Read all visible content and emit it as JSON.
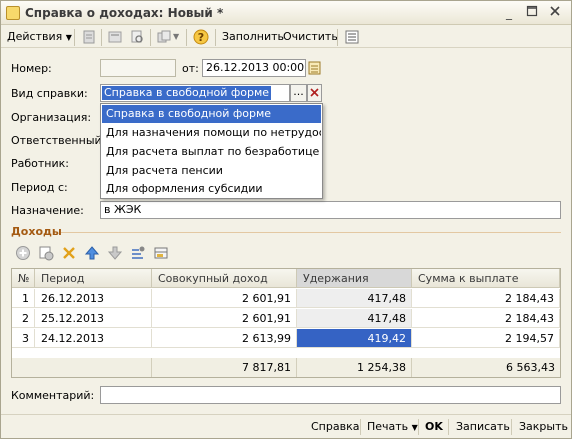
{
  "window": {
    "title": "Справка о доходах: Новый *"
  },
  "toolbar": {
    "actions_label": "Действия",
    "fill_label": "Заполнить",
    "clear_label": "Очистить"
  },
  "form": {
    "number_label": "Номер:",
    "number_value": "",
    "from_label": "от:",
    "date_value": "26.12.2013 00:00:00",
    "cert_type_label": "Вид справки:",
    "cert_type_value": "Справка в свободной форме",
    "org_label": "Организация:",
    "responsible_label": "Ответственный:",
    "employee_label": "Работник:",
    "period_label": "Период с:",
    "purpose_label": "Назначение:",
    "purpose_value": "в ЖЭК",
    "comment_label": "Комментарий:",
    "comment_value": ""
  },
  "dropdown": {
    "options": [
      "Справка в свободной форме",
      "Для назначения помощи по нетрудоспо...",
      "Для расчета выплат по безработице",
      "Для расчета пенсии",
      "Для оформления субсидии"
    ],
    "selected_index": 0
  },
  "income": {
    "section_label": "Доходы",
    "columns": [
      "№",
      "Период",
      "Совокупный доход",
      "Удержания",
      "Сумма к выплате"
    ],
    "rows": [
      {
        "n": "1",
        "period": "26.12.2013",
        "total": "2 601,91",
        "deduct": "417,48",
        "pay": "2 184,43"
      },
      {
        "n": "2",
        "period": "25.12.2013",
        "total": "2 601,91",
        "deduct": "417,48",
        "pay": "2 184,43"
      },
      {
        "n": "3",
        "period": "24.12.2013",
        "total": "2 613,99",
        "deduct": "419,42",
        "pay": "2 194,57"
      }
    ],
    "totals": {
      "total": "7 817,81",
      "deduct": "1 254,38",
      "pay": "6 563,43"
    }
  },
  "buttons": {
    "report": "Справка",
    "print": "Печать",
    "ok": "OK",
    "save": "Записать",
    "close": "Закрыть"
  }
}
